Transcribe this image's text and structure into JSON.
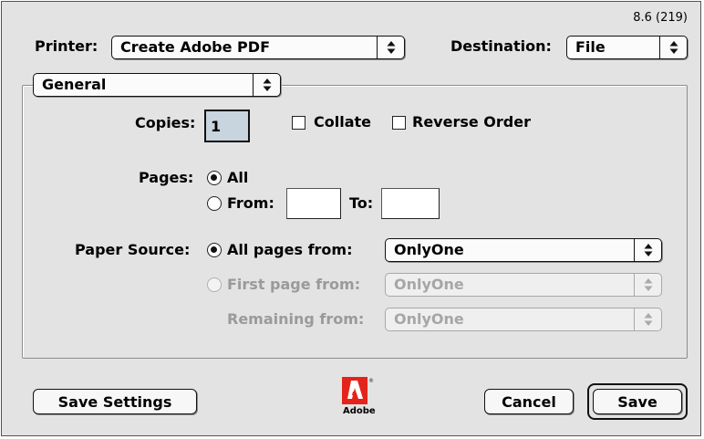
{
  "dialog": {
    "version": "8.6 (219)"
  },
  "printer": {
    "label": "Printer:",
    "value": "Create Adobe PDF"
  },
  "destination": {
    "label": "Destination:",
    "value": "File"
  },
  "panel": {
    "value": "General"
  },
  "copies": {
    "label": "Copies:",
    "value": "1",
    "collate_label": "Collate",
    "collate_checked": false,
    "reverse_label": "Reverse Order",
    "reverse_checked": false
  },
  "pages": {
    "label": "Pages:",
    "all_label": "All",
    "from_label": "From:",
    "from_value": "",
    "to_label": "To:",
    "to_value": "",
    "selected": "all"
  },
  "paper_source": {
    "label": "Paper Source:",
    "all_pages_label": "All pages from:",
    "all_pages_value": "OnlyOne",
    "first_page_label": "First page from:",
    "first_page_value": "OnlyOne",
    "remaining_label": "Remaining from:",
    "remaining_value": "OnlyOne",
    "selected": "all_pages"
  },
  "buttons": {
    "save_settings": "Save Settings",
    "cancel": "Cancel",
    "save": "Save"
  },
  "logo": {
    "text": "Adobe",
    "brand_color": "#e4241b"
  },
  "icons": {
    "popup_arrows": "double-arrow-updown-icon",
    "logo": "adobe-logo-icon"
  }
}
